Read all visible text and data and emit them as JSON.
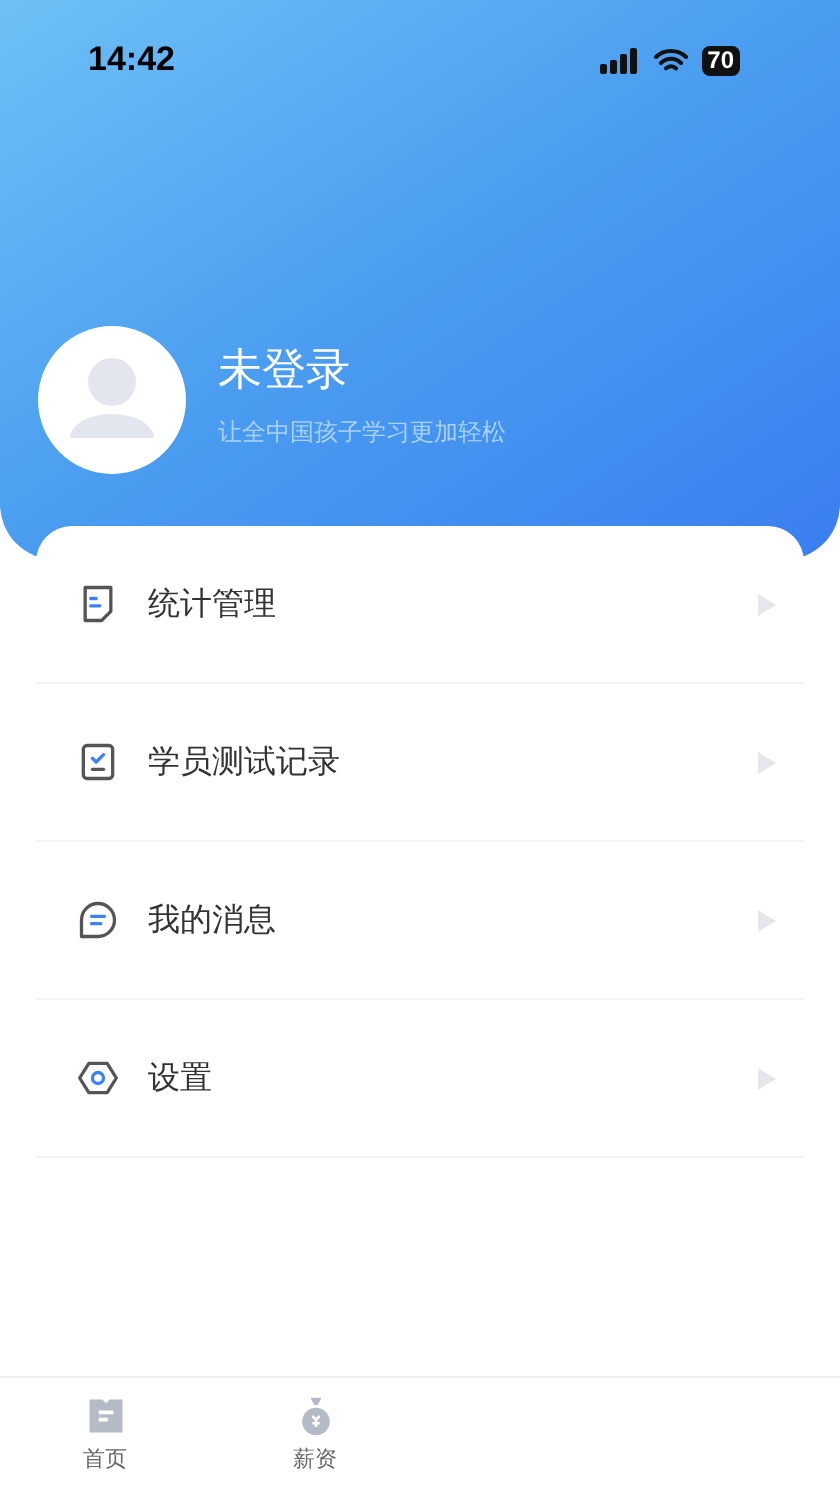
{
  "status_bar": {
    "time": "14:42",
    "battery": "70"
  },
  "profile": {
    "name": "未登录",
    "tagline": "让全中国孩子学习更加轻松"
  },
  "menu": [
    {
      "kind": "stats",
      "label": "统计管理"
    },
    {
      "kind": "tests",
      "label": "学员测试记录"
    },
    {
      "kind": "messages",
      "label": "我的消息"
    },
    {
      "kind": "settings",
      "label": "设置"
    }
  ],
  "tab_bar": [
    {
      "kind": "home",
      "label": "首页"
    },
    {
      "kind": "salary",
      "label": "薪资"
    }
  ]
}
